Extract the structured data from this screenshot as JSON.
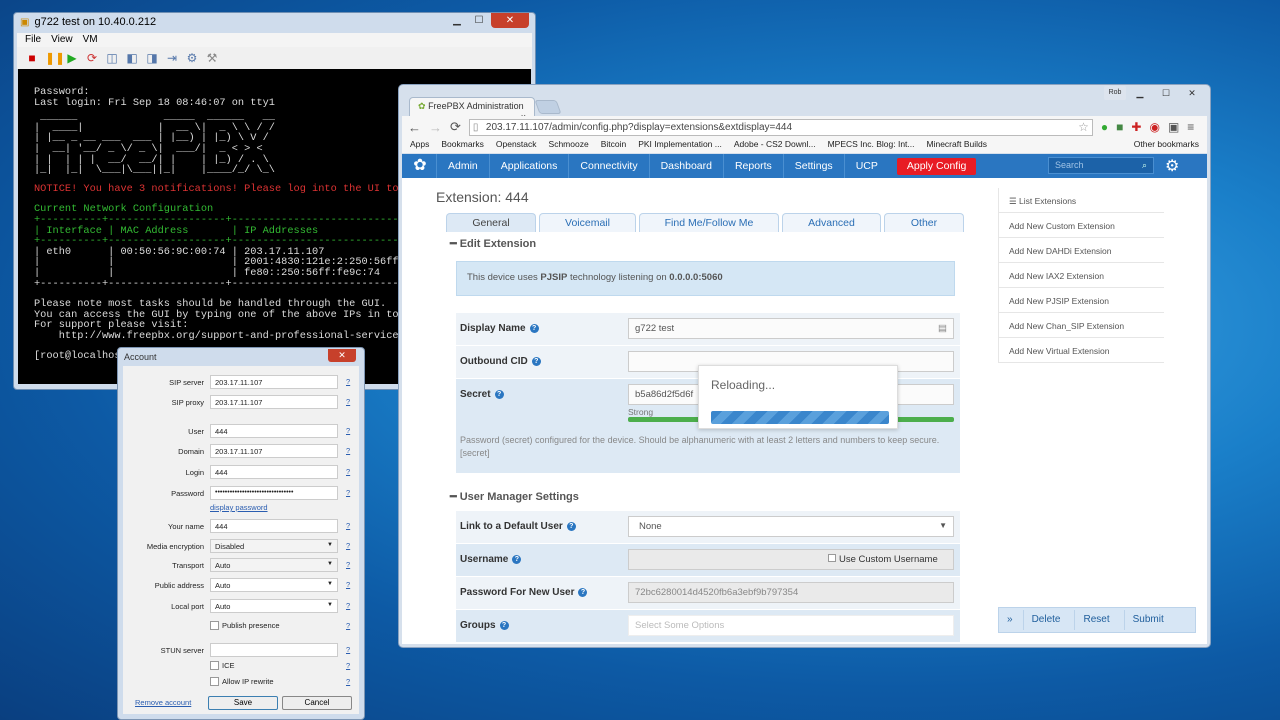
{
  "vm": {
    "title": "g722 test on 10.40.0.212",
    "menu": [
      "File",
      "View",
      "VM"
    ],
    "console": {
      "l1": "Password:",
      "l2": "Last login: Fri Sep 18 08:46:07 on tty1",
      "logo": " ______              _____  ______   __\n|  ____|            |  __ \\|  _ \\ \\ / /\n| |__ _ __ ___  ___ | |__) | |_) \\ V / \n|  __| '__/ _ \\/ _ \\|  ___/|  _ < > <  \n| |  | | |  __/  __/| |    | |_) / . \\ \n|_|  |_|  \\___|\\___||_|    |____/_/ \\_\\",
      "notice": "NOTICE! You have 3 notifications! Please log into the UI to",
      "netcfg": "Current Network Configuration",
      "tablehead": "+----------+-------------------+---------------------------\n| Interface | MAC Address       | IP Addresses\n+----------+-------------------+---------------------------",
      "tablebody": "| eth0      | 00:50:56:9C:00:74 | 203.17.11.107\n|           |                   | 2001:4830:121e:2:250:56ff:f\n|           |                   | fe80::250:56ff:fe9c:74\n+----------+-------------------+---------------------------",
      "note": "Please note most tasks should be handled through the GUI.\nYou can access the GUI by typing one of the above IPs in to y\nFor support please visit:\n    http://www.freepbx.org/support-and-professional-services",
      "prompt": "[root@localhost ~]#"
    }
  },
  "browser": {
    "tab": "FreePBX Administration",
    "user": "Rob",
    "url": "203.17.11.107/admin/config.php?display=extensions&extdisplay=444",
    "bookmarks": [
      "Apps",
      "Bookmarks",
      "Openstack",
      "Schmooze",
      "Bitcoin",
      "PKI Implementation ...",
      "Adobe - CS2 Downl...",
      "MPECS Inc. Blog: Int...",
      "Minecraft Builds"
    ],
    "other_bookmarks": "Other bookmarks"
  },
  "fpnav": {
    "items": [
      "Admin",
      "Applications",
      "Connectivity",
      "Dashboard",
      "Reports",
      "Settings",
      "UCP"
    ],
    "apply": "Apply Config",
    "search_placeholder": "Search"
  },
  "ext": {
    "heading": "Extension: 444",
    "tabs": [
      "General",
      "Voicemail",
      "Find Me/Follow Me",
      "Advanced",
      "Other"
    ],
    "edit_section": "Edit Extension",
    "info_pre": "This device uses ",
    "info_tech": "PJSIP",
    "info_mid": " technology listening on ",
    "info_addr": "0.0.0.0:5060",
    "display_name_label": "Display Name",
    "display_name": "g722 test",
    "outbound_cid_label": "Outbound CID",
    "outbound_cid": "",
    "secret_label": "Secret",
    "secret": "b5a86d2f5d6f",
    "strength": "Strong",
    "secret_help": "Password (secret) configured for the device. Should be alphanumeric with at least 2 letters and numbers to keep secure. [secret]",
    "um_section": "User Manager Settings",
    "link_label": "Link to a Default User",
    "link_value": "None",
    "username_label": "Username",
    "custom_username": "Use Custom Username",
    "pwd_label": "Password For New User",
    "pwd_value": "72bc6280014d4520fb6a3ebf9b797354",
    "groups_label": "Groups",
    "groups_placeholder": "Select Some Options",
    "reloading": "Reloading..."
  },
  "sidebar": [
    "List Extensions",
    "Add New Custom Extension",
    "Add New DAHDi Extension",
    "Add New IAX2 Extension",
    "Add New PJSIP Extension",
    "Add New Chan_SIP Extension",
    "Add New Virtual Extension"
  ],
  "buttons": {
    "delete": "Delete",
    "reset": "Reset",
    "submit": "Submit"
  },
  "account": {
    "title": "Account",
    "sip_server_label": "SIP server",
    "sip_server": "203.17.11.107",
    "sip_proxy_label": "SIP proxy",
    "sip_proxy": "203.17.11.107",
    "user_label": "User",
    "user": "444",
    "domain_label": "Domain",
    "domain": "203.17.11.107",
    "login_label": "Login",
    "login": "444",
    "password_label": "Password",
    "password": "••••••••••••••••••••••••••••••••",
    "display_password": "display password",
    "your_name_label": "Your name",
    "your_name": "444",
    "media_enc_label": "Media encryption",
    "media_enc": "Disabled",
    "transport_label": "Transport",
    "transport": "Auto",
    "public_addr_label": "Public address",
    "public_addr": "Auto",
    "local_port_label": "Local port",
    "local_port": "Auto",
    "publish_presence": "Publish presence",
    "stun_label": "STUN server",
    "stun": "",
    "ice": "ICE",
    "allow_ip_rewrite": "Allow IP rewrite",
    "remove": "Remove account",
    "save": "Save",
    "cancel": "Cancel",
    "help": "?"
  }
}
